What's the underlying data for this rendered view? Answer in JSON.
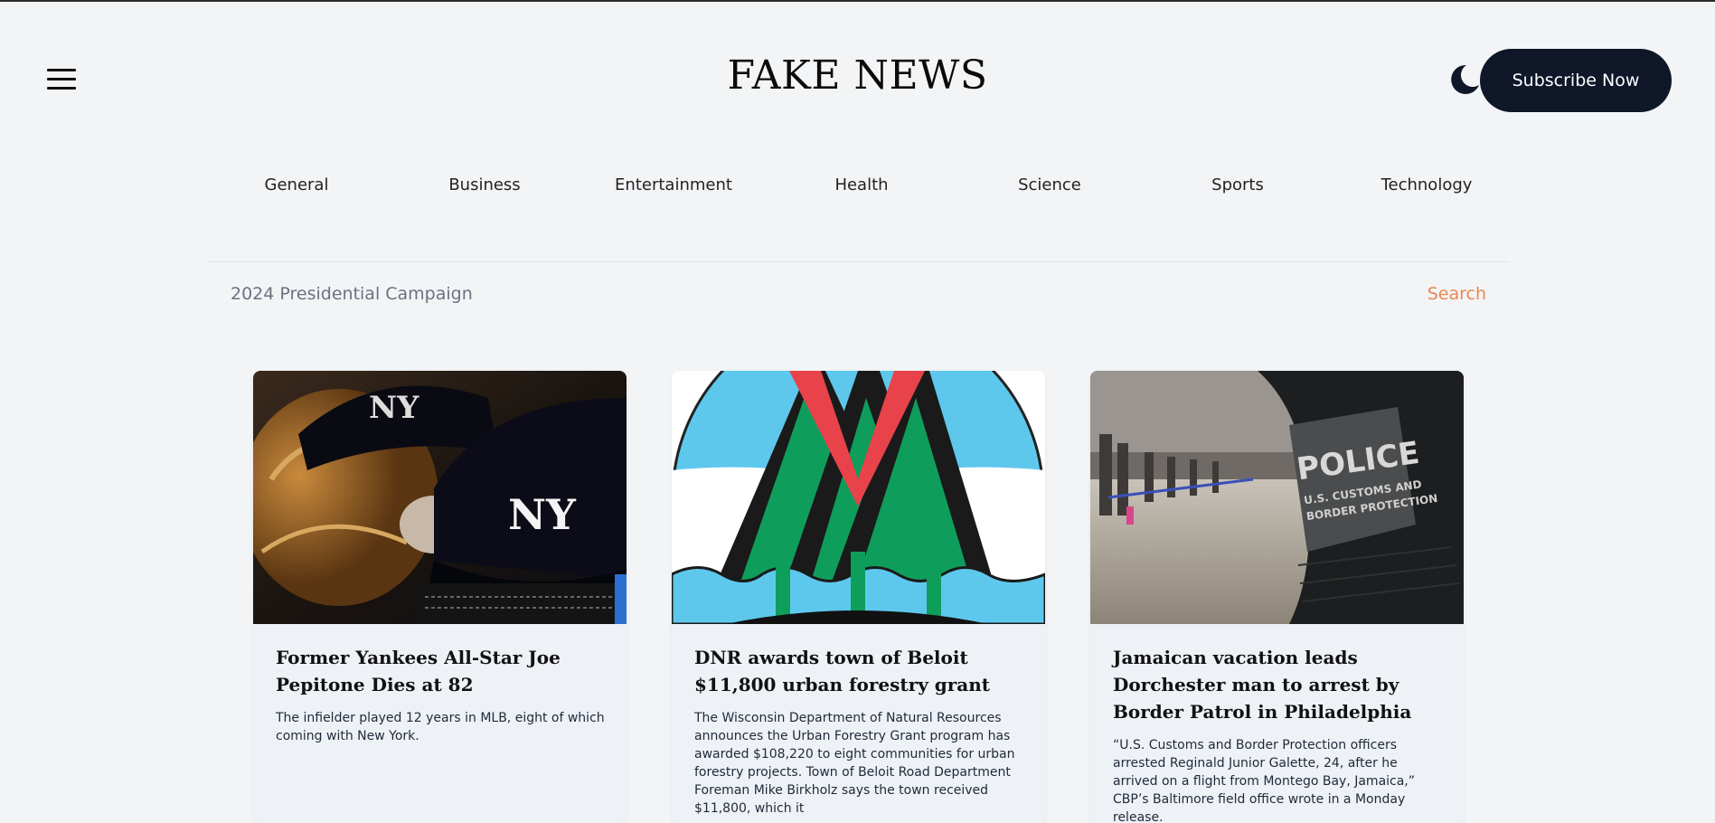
{
  "header": {
    "logo": "FAKE NEWS",
    "menu_icon": "hamburger-menu-icon",
    "theme_icon": "moon-icon",
    "subscribe_label": "Subscribe Now"
  },
  "categories": [
    "General",
    "Business",
    "Entertainment",
    "Health",
    "Science",
    "Sports",
    "Technology"
  ],
  "subheader": {
    "topic": "2024 Presidential Campaign",
    "search_label": "Search"
  },
  "articles": [
    {
      "title": "Former Yankees All-Star Joe Pepitone Dies at 82",
      "description": "The infielder played 12 years in MLB, eight of which coming with New York.",
      "image": "yankees-cap-and-glove-photo"
    },
    {
      "title": "DNR awards town of Beloit $11,800 urban forestry grant",
      "description": "The Wisconsin Department of Natural Resources announces the Urban Forestry Grant program has awarded $108,220 to eight communities for urban forestry projects. Town of Beloit Road Department Foreman Mike Birkholz says the town received $11,800, which it",
      "image": "town-of-beloit-logo"
    },
    {
      "title": "Jamaican vacation leads Dorchester man to arrest by Border Patrol in Philadelphia",
      "description": "“U.S. Customs and Border Protection officers arrested Reginald Junior Galette, 24, after he arrived on a flight from Montego Bay, Jamaica,” CBP’s Baltimore field office wrote in a Monday release.",
      "image": "cbp-officer-airport-photo",
      "badge_text": [
        "POLICE",
        "U.S. CUSTOMS AND",
        "BORDER PROTECTION"
      ]
    }
  ],
  "colors": {
    "background": "#f3f4f6",
    "subscribe_bg": "#0f1729",
    "search_accent": "#e8884f",
    "muted_text": "#6b7280",
    "card_bg": "#eef2f7"
  }
}
